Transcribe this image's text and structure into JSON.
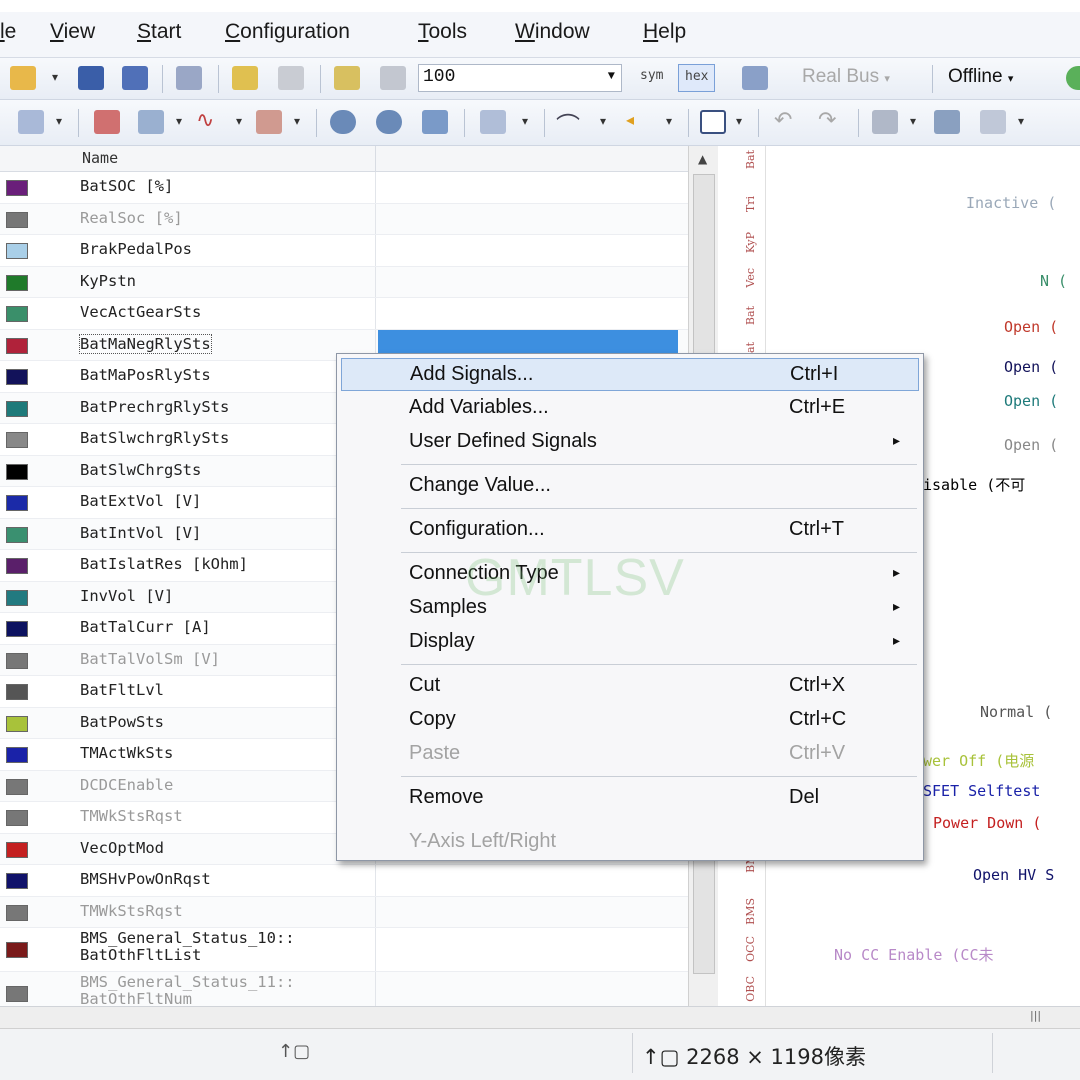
{
  "menubar": {
    "items": [
      "le",
      "View",
      "Start",
      "Configuration",
      "Tools",
      "Window",
      "Help"
    ]
  },
  "toolbar1": {
    "zoom_value": "100",
    "sym_label": "sym",
    "hex_label": "hex",
    "bus_label": "Real Bus",
    "mode_label": "Offline"
  },
  "signals": {
    "header_name": "Name",
    "rows": [
      {
        "name": "BatSOC [%]",
        "color": "#6a1f7a",
        "dim": false
      },
      {
        "name": "RealSoc [%]",
        "color": "#777777",
        "dim": true
      },
      {
        "name": "BrakPedalPos",
        "color": "#a9cfe8",
        "dim": false
      },
      {
        "name": "KyPstn",
        "color": "#1f7a2a",
        "dim": false
      },
      {
        "name": "VecActGearSts",
        "color": "#3a8f6a",
        "dim": false
      },
      {
        "name": "BatMaNegRlySts",
        "color": "#b0223a",
        "dim": false,
        "selected": true
      },
      {
        "name": "BatMaPosRlySts",
        "color": "#12125a",
        "dim": false
      },
      {
        "name": "BatPrechrgRlySts",
        "color": "#1e7a7a",
        "dim": false
      },
      {
        "name": "BatSlwchrgRlySts",
        "color": "#888888",
        "dim": false
      },
      {
        "name": "BatSlwChrgSts",
        "color": "#000000",
        "dim": false
      },
      {
        "name": "BatExtVol [V]",
        "color": "#1b2aa8",
        "dim": false
      },
      {
        "name": "BatIntVol [V]",
        "color": "#3a9070",
        "dim": false
      },
      {
        "name": "BatIslatRes [kOhm]",
        "color": "#5a1f6a",
        "dim": false
      },
      {
        "name": "InvVol [V]",
        "color": "#227a80",
        "dim": false
      },
      {
        "name": "BatTalCurr [A]",
        "color": "#0c1260",
        "dim": false
      },
      {
        "name": "BatTalVolSm [V]",
        "color": "#777777",
        "dim": true
      },
      {
        "name": "BatFltLvl",
        "color": "#555555",
        "dim": false
      },
      {
        "name": "BatPowSts",
        "color": "#a8c23a",
        "dim": false
      },
      {
        "name": "TMActWkSts",
        "color": "#1a22a8",
        "dim": false
      },
      {
        "name": "DCDCEnable",
        "color": "#777777",
        "dim": true
      },
      {
        "name": "TMWkStsRqst",
        "color": "#777777",
        "dim": true
      },
      {
        "name": "VecOptMod",
        "color": "#c42020",
        "dim": false
      },
      {
        "name": "BMSHvPowOnRqst",
        "color": "#10126a",
        "dim": false
      },
      {
        "name": "TMWkStsRqst",
        "color": "#777777",
        "dim": true
      },
      {
        "name": "BMS_General_Status_10::\nBatOthFltList",
        "color": "#7a1a1a",
        "dim": false
      },
      {
        "name": "BMS_General_Status_11::\nBatOthFltNum",
        "color": "#777777",
        "dim": true
      }
    ]
  },
  "context_menu": {
    "items": [
      {
        "label": "Add Signals...",
        "shortcut": "Ctrl+I",
        "submenu": false,
        "disabled": false,
        "hot": true
      },
      {
        "label": "Add Variables...",
        "shortcut": "Ctrl+E",
        "submenu": false,
        "disabled": false
      },
      {
        "label": "User Defined Signals",
        "shortcut": "",
        "submenu": true,
        "disabled": false
      },
      {
        "label": "Change Value...",
        "shortcut": "",
        "submenu": false,
        "disabled": false
      },
      {
        "label": "Configuration...",
        "shortcut": "Ctrl+T",
        "submenu": false,
        "disabled": false
      },
      {
        "label": "Connection Type",
        "shortcut": "",
        "submenu": true,
        "disabled": false
      },
      {
        "label": "Samples",
        "shortcut": "",
        "submenu": true,
        "disabled": false
      },
      {
        "label": "Display",
        "shortcut": "",
        "submenu": true,
        "disabled": false
      },
      {
        "label": "Cut",
        "shortcut": "Ctrl+X",
        "submenu": false,
        "disabled": false
      },
      {
        "label": "Copy",
        "shortcut": "Ctrl+C",
        "submenu": false,
        "disabled": false
      },
      {
        "label": "Paste",
        "shortcut": "Ctrl+V",
        "submenu": false,
        "disabled": true
      },
      {
        "label": "Remove",
        "shortcut": "Del",
        "submenu": false,
        "disabled": false
      },
      {
        "label": "Y-Axis Left/Right",
        "shortcut": "",
        "submenu": false,
        "disabled": true
      }
    ]
  },
  "graph": {
    "axis_labels": [
      "Bat",
      "Tri",
      "KyP",
      "Vec",
      "Bat",
      "Bat",
      "BMS",
      "BMS",
      "OCC",
      "OBC"
    ],
    "labels": [
      {
        "text": "Inactive (",
        "color": "#9aa8b8"
      },
      {
        "text": "N (",
        "color": "#3a8f6a"
      },
      {
        "text": "Open (",
        "color": "#c0392b"
      },
      {
        "text": "Open (",
        "color": "#12125a"
      },
      {
        "text": "Open (",
        "color": "#1e7a7a"
      },
      {
        "text": "Open (",
        "color": "#888888"
      },
      {
        "text": "isable (不可",
        "color": "#000000"
      },
      {
        "text": "Normal (",
        "color": "#555555"
      },
      {
        "text": "wer Off (电源",
        "color": "#a8c23a"
      },
      {
        "text": "SFET Selftest",
        "color": "#1a22a8"
      },
      {
        "text": "Power Down (",
        "color": "#c42020"
      },
      {
        "text": "Open HV S",
        "color": "#10126a"
      },
      {
        "text": "No CC Enable (CC未",
        "color": "#b889c8"
      }
    ]
  },
  "watermark": "GMTLSV",
  "statusbar": {
    "dims": "2268 × 1198像素"
  }
}
